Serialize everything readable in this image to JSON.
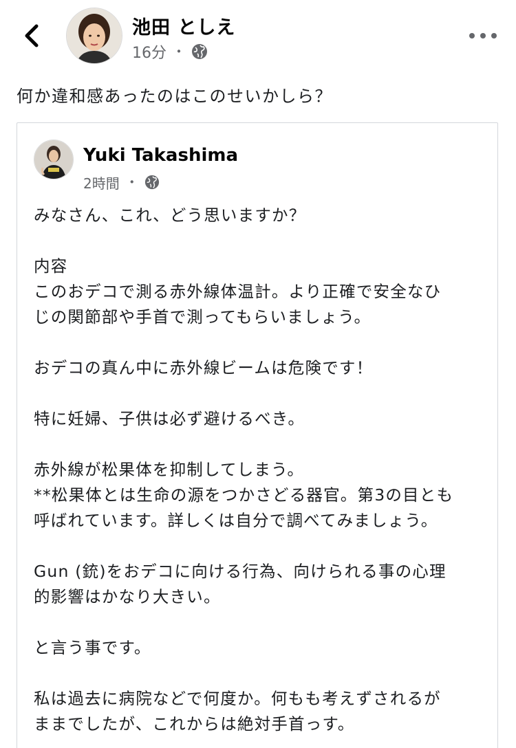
{
  "header": {
    "author": "池田 としえ",
    "time": "16分",
    "separator": "・",
    "privacy_icon": "globe-icon",
    "back_icon": "chevron-left-icon",
    "more_icon": "more-horizontal-icon"
  },
  "post": {
    "text": "何か違和感あったのはこのせいかしら？"
  },
  "shared": {
    "author": "Yuki Takashima",
    "time": "2時間",
    "separator": "・",
    "privacy_icon": "globe-icon",
    "paragraphs": [
      {
        "lines": [
          "みなさん、これ、どう思いますか？"
        ]
      },
      {
        "lines": [
          "内容",
          "このおデコで測る赤外線体温計。より正確で安全なひ",
          "じの関節部や手首で測ってもらいましょう。"
        ]
      },
      {
        "lines": [
          "おデコの真ん中に赤外線ビームは危険です！"
        ]
      },
      {
        "lines": [
          "特に妊婦、子供は必ず避けるべき。"
        ]
      },
      {
        "lines": [
          "赤外線が松果体を抑制してしまう。",
          "**松果体とは生命の源をつかさどる器官。第3の目とも",
          "呼ばれています。詳しくは自分で調べてみましょう。"
        ]
      },
      {
        "lines": [
          "Gun (銃)をおデコに向ける行為、向けられる事の心理",
          "的影響はかなり大きい。"
        ]
      },
      {
        "lines": [
          "と言う事です。"
        ]
      },
      {
        "lines": [
          "私は過去に病院などで何度か。何もも考えずされるが",
          "ままでしたが、これからは絶対手首っす。"
        ]
      }
    ]
  },
  "colors": {
    "text": "#1c1e21",
    "meta": "#65676b",
    "border": "#d3d6db"
  }
}
